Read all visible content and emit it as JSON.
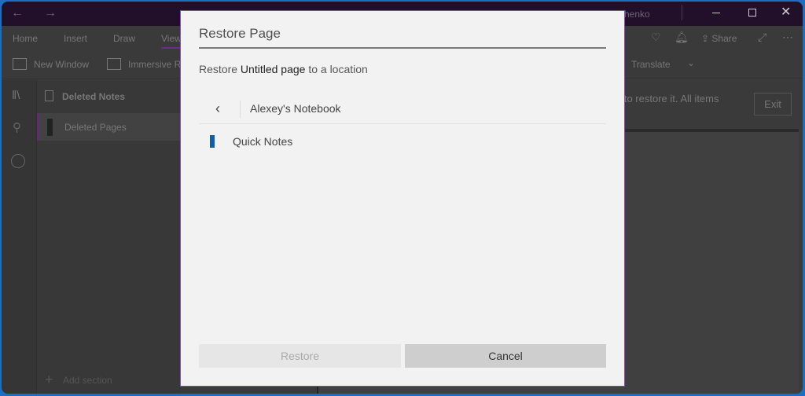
{
  "window": {
    "title_fragment": "henko",
    "nav_back": "←",
    "nav_forward": "→"
  },
  "ribbon": {
    "tabs": [
      "Home",
      "Insert",
      "Draw",
      "View"
    ],
    "share": "Share"
  },
  "toolbar": {
    "new_window": "New Window",
    "immersive": "Immersive R",
    "translate": "Translate"
  },
  "sections": {
    "header": "Deleted Notes",
    "items": [
      {
        "label": "Deleted Pages"
      }
    ],
    "add_section": "Add section"
  },
  "infobar": {
    "text": "n to restore it. All items",
    "exit": "Exit"
  },
  "dialog": {
    "title": "Restore Page",
    "message_prefix": "Restore ",
    "page_name": "Untitled page",
    "message_suffix": " to a location",
    "back": "‹",
    "notebook": "Alexey's Notebook",
    "locations": [
      {
        "label": "Quick Notes",
        "color": "#0f5ea8"
      }
    ],
    "restore_label": "Restore",
    "cancel_label": "Cancel"
  }
}
